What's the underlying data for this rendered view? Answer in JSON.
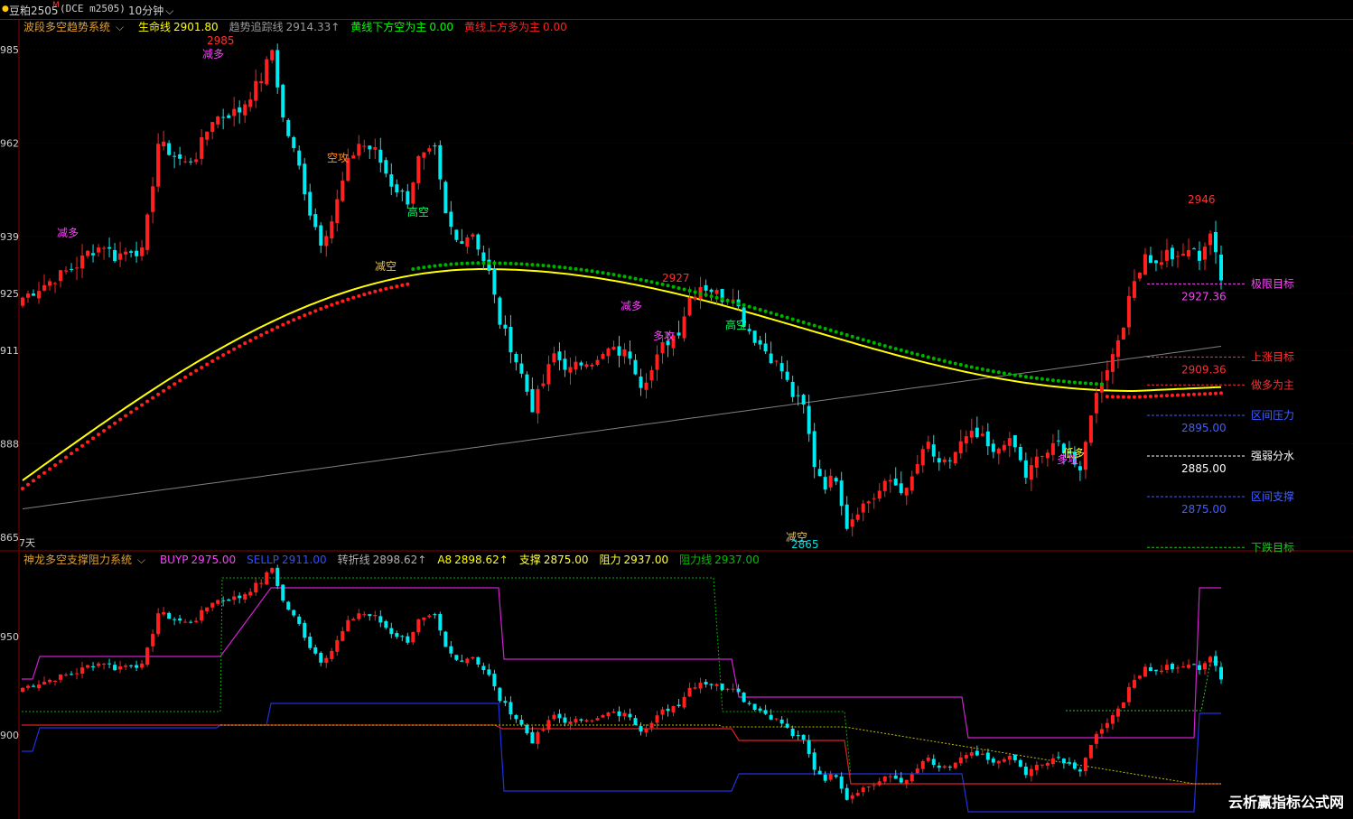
{
  "topbar": {
    "symbol": "豆粕2505",
    "symbol_mark": "M",
    "exchange": "(DCE m2505)",
    "period": "10分钟"
  },
  "main_panel": {
    "indicator_name": "波段多空趋势系统",
    "items": [
      {
        "label": "生命线",
        "value": "2901.80",
        "color": "#ffff00"
      },
      {
        "label": "趋势追踪线",
        "value": "2914.33↑",
        "color": "#9a9a9a"
      },
      {
        "label": "黄线下方空为主",
        "value": "0.00",
        "color": "#00ff00"
      },
      {
        "label": "黄线上方多为主",
        "value": "0.00",
        "color": "#ff2020"
      }
    ],
    "y_ticks": [
      "985",
      "962",
      "939",
      "925",
      "911",
      "888",
      "865"
    ],
    "y_tick_values": [
      2985,
      2962,
      2939,
      2925,
      2911,
      2888,
      2865
    ],
    "period_label": "7天",
    "annotations": [
      {
        "text": "2985",
        "color": "#ff3030"
      },
      {
        "text": "减多",
        "color": "#ff40ff"
      },
      {
        "text": "减多",
        "color": "#ff40ff"
      },
      {
        "text": "空攻",
        "color": "#ff9020"
      },
      {
        "text": "高空",
        "color": "#00ff60"
      },
      {
        "text": "减空",
        "color": "#e0c060"
      },
      {
        "text": "2927",
        "color": "#ff3030"
      },
      {
        "text": "减多",
        "color": "#ff40ff"
      },
      {
        "text": "多攻",
        "color": "#ff40ff"
      },
      {
        "text": "高空",
        "color": "#00ff60"
      },
      {
        "text": "减空",
        "color": "#e0c060"
      },
      {
        "text": "2865",
        "color": "#00e0e0"
      },
      {
        "text": "低多",
        "color": "#ffff00"
      },
      {
        "text": "多攻",
        "color": "#ff40ff"
      },
      {
        "text": "2946",
        "color": "#ff3030"
      }
    ],
    "levels": [
      {
        "label": "极限目标",
        "value": "2927.36",
        "color": "#ff40ff",
        "price": 2927.36
      },
      {
        "label": "上涨目标",
        "value": "2909.36",
        "color": "#ff3030",
        "price": 2909.36
      },
      {
        "label": "做多为主",
        "value": "",
        "color": "#ff3030",
        "price": 2902.5
      },
      {
        "label": "区间压力",
        "value": "2895.00",
        "color": "#4060ff",
        "price": 2895
      },
      {
        "label": "强弱分水",
        "value": "2885.00",
        "color": "#ffffff",
        "price": 2885
      },
      {
        "label": "区间支撑",
        "value": "2875.00",
        "color": "#4060ff",
        "price": 2875
      },
      {
        "label": "下跌目标",
        "value": "",
        "color": "#20c020",
        "price": 2862.5
      }
    ]
  },
  "sub_panel": {
    "indicator_name": "神龙多空支撑阻力系统",
    "items": [
      {
        "label": "BUYP",
        "value": "2975.00",
        "color": "#ff40ff"
      },
      {
        "label": "SELLP",
        "value": "2911.00",
        "color": "#3050ff"
      },
      {
        "label": "转折线",
        "value": "2898.62↑",
        "color": "#b0b0b0"
      },
      {
        "label": "A8",
        "value": "2898.62↑",
        "color": "#ffff00"
      },
      {
        "label": "支撑",
        "value": "2875.00",
        "color": "#ffff40"
      },
      {
        "label": "阻力",
        "value": "2937.00",
        "color": "#ffff40"
      },
      {
        "label": "阻力线",
        "value": "2937.00",
        "color": "#00c000"
      }
    ],
    "y_ticks": [
      "950",
      "900"
    ]
  },
  "watermark": "云析赢指标公式网",
  "colors": {
    "up": "#ff2020",
    "down": "#00e8f0",
    "life_line": "#ffff00",
    "trend_line": "#808080",
    "dot_bull": "#ff2020",
    "dot_bear": "#00b000"
  }
}
